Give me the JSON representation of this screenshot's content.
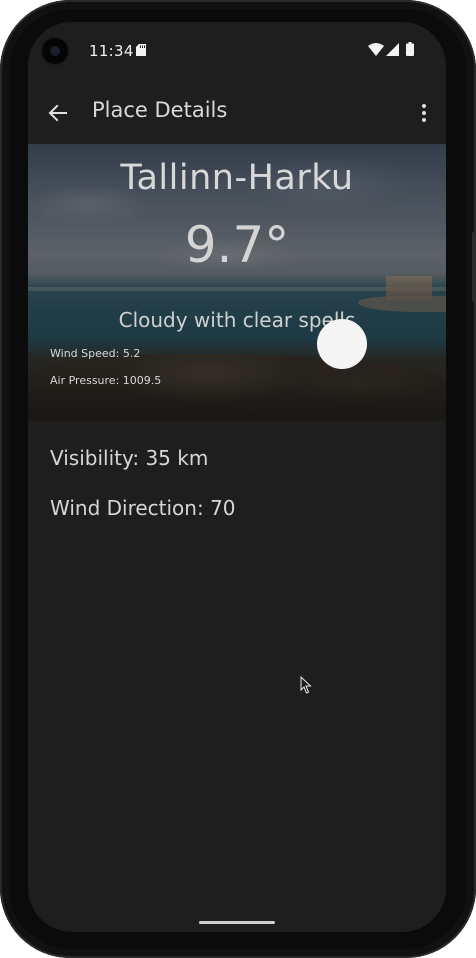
{
  "status_bar": {
    "time": "11:34",
    "icons": [
      "camera-icon",
      "sd-card-icon",
      "wifi-icon",
      "signal-icon",
      "battery-icon"
    ]
  },
  "app_bar": {
    "title": "Place Details",
    "back_icon": "arrow-back-icon",
    "overflow_icon": "more-vert-icon"
  },
  "weather": {
    "location": "Tallinn-Harku",
    "temperature": "9.7°",
    "condition": "Cloudy with clear spells",
    "wind_speed": "Wind Speed: 5.2",
    "air_pressure": "Air Pressure: 1009.5"
  },
  "details": {
    "visibility": "Visibility: 35 km",
    "wind_direction": "Wind Direction: 70"
  },
  "colors": {
    "background": "#1e1e1f",
    "text": "#d6d6d6"
  }
}
